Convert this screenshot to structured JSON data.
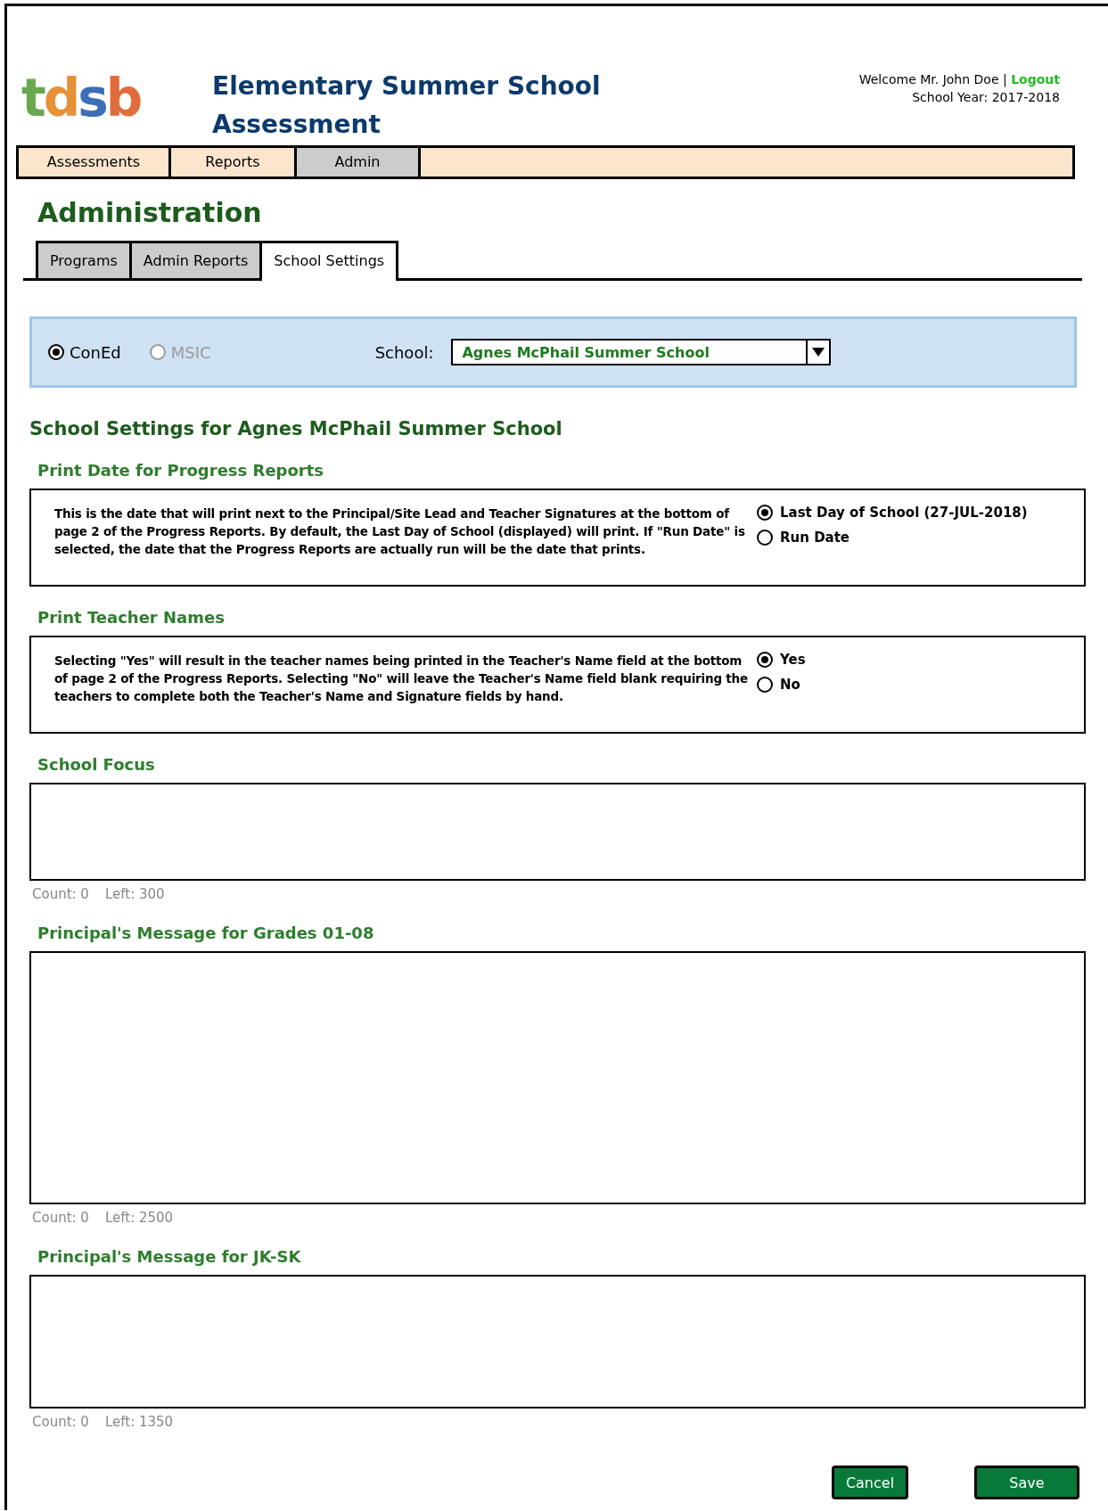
{
  "header": {
    "logo": "tdsb",
    "title": "Elementary Summer School Assessment",
    "welcome": "Welcome Mr. John Doe |",
    "logout": "Logout",
    "school_year": "School Year: 2017-2018"
  },
  "nav": [
    {
      "label": "Assessments",
      "selected": false
    },
    {
      "label": "Reports",
      "selected": false
    },
    {
      "label": "Admin",
      "selected": true
    }
  ],
  "page_title": "Administration",
  "tabs": [
    {
      "label": "Programs",
      "selected": false
    },
    {
      "label": "Admin Reports",
      "selected": false
    },
    {
      "label": "School Settings",
      "selected": true
    }
  ],
  "filter": {
    "programs": [
      {
        "label": "ConEd",
        "selected": true,
        "disabled": false
      },
      {
        "label": "MSIC",
        "selected": false,
        "disabled": true
      }
    ],
    "school_label": "School:",
    "school_value": "Agnes McPhail Summer School"
  },
  "settings_title": "School Settings for Agnes McPhail Summer School",
  "sections": [
    {
      "kind": "options",
      "title": "Print Date for Progress Reports",
      "description": "This is the date that will print next to the Principal/Site Lead and Teacher Signatures at the bottom of page 2 of the Progress Reports. By default, the Last Day of School (displayed) will print. If \"Run Date\" is selected, the date that the Progress Reports are actually run will be the date that prints.",
      "options": [
        {
          "label": "Last Day of School (27-JUL-2018)",
          "selected": true
        },
        {
          "label": "Run Date",
          "selected": false
        }
      ]
    },
    {
      "kind": "options",
      "title": "Print Teacher Names",
      "description": "Selecting \"Yes\" will result in the teacher names being printed in the Teacher's Name field at the bottom of page 2 of the Progress Reports. Selecting \"No\" will leave the Teacher's Name field blank requiring the teachers to complete both the Teacher's Name and Signature fields by hand.",
      "options": [
        {
          "label": "Yes",
          "selected": true
        },
        {
          "label": "No",
          "selected": false
        }
      ]
    },
    {
      "kind": "text",
      "title": "School Focus",
      "count": "Count: 0",
      "left": "Left: 300"
    },
    {
      "kind": "text",
      "title": "Principal's Message for Grades 01-08",
      "count": "Count: 0",
      "left": "Left: 2500"
    },
    {
      "kind": "text",
      "title": "Principal's Message for JK-SK",
      "count": "Count: 0",
      "left": "Left: 1350"
    }
  ],
  "buttons": [
    {
      "label": "Cancel"
    },
    {
      "label": "Save"
    }
  ]
}
